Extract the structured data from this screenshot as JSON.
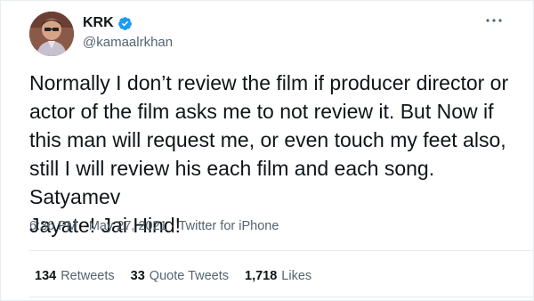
{
  "author": {
    "display_name": "KRK",
    "handle": "@kamaalrkhan",
    "verified": true,
    "verified_color": "#1d9bf0"
  },
  "tweet": {
    "text": "Normally I don’t review the film if producer director or\nactor of the film asks me to not review it. But Now if\nthis man will request me, or even touch my feet also,\nstill I will review his each film and each song. Satyamev\nJayate! Jai Hind!",
    "time": "6:36 PM",
    "separator": "·",
    "date": "May 27, 2021",
    "source": "Twitter for iPhone"
  },
  "stats": {
    "retweets_count": "134",
    "retweets_label": "Retweets",
    "quotes_count": "33",
    "quotes_label": "Quote Tweets",
    "likes_count": "1,718",
    "likes_label": "Likes"
  },
  "icons": {
    "more": "more-horizontal-icon",
    "verified": "verified-badge-icon"
  }
}
